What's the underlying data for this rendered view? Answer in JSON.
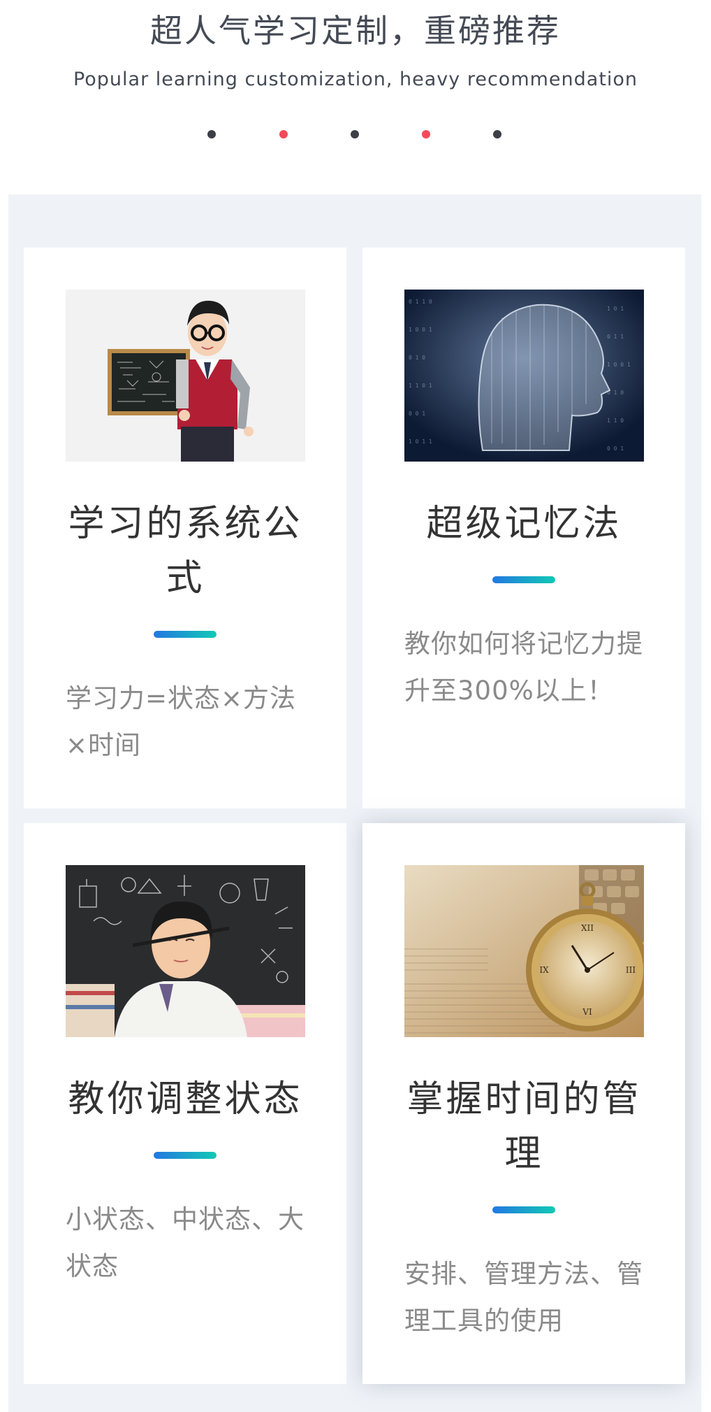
{
  "header": {
    "title": "超人气学习定制，重磅推荐",
    "subtitle": "Popular learning customization, heavy recommendation"
  },
  "dots": [
    {
      "color": "#3d3f47"
    },
    {
      "color": "#f24b5a"
    },
    {
      "color": "#3d3f47"
    },
    {
      "color": "#f24b5a"
    },
    {
      "color": "#3d3f47"
    }
  ],
  "colors": {
    "panel_background": "#eff3f8",
    "accent_gradient_start": "#2378e1",
    "accent_gradient_end": "#11c9b5"
  },
  "cards": [
    {
      "title": "学习的系统公式",
      "description": "学习力=状态×方法×时间",
      "image": "boy-with-chalkboard-photo"
    },
    {
      "title": "超级记忆法",
      "description": "教你如何将记忆力提升至300%以上！",
      "image": "digital-head-binary-photo"
    },
    {
      "title": "教你调整状态",
      "description": "小状态、中状态、大状态",
      "image": "boy-with-pencil-photo"
    },
    {
      "title": "掌握时间的管理",
      "description": "安排、管理方法、管理工具的使用",
      "image": "pocket-watch-photo"
    }
  ]
}
